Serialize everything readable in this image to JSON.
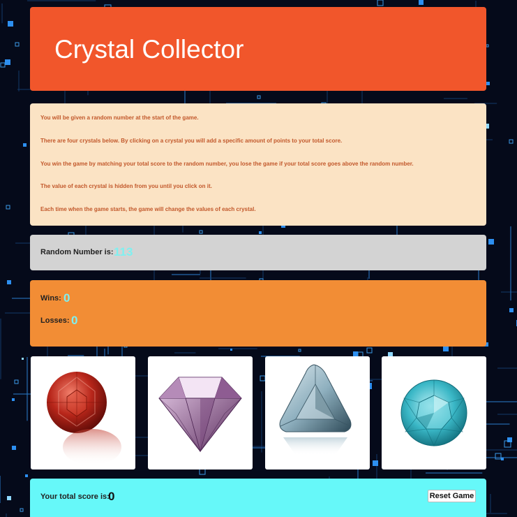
{
  "header": {
    "title": "Crystal Collector"
  },
  "instructions": [
    "You will be given a random number at the start of the game.",
    "There are four crystals below. By clicking on a crystal you will add a specific amount of points to your total score.",
    "You win the game by matching your total score to the random number, you lose the game if your total score goes above the random number.",
    "The value of each crystal is hidden from you until you click on it.",
    "Each time when the game starts, the game will change the values of each crystal."
  ],
  "random": {
    "label": "Random Number is:",
    "value": "113"
  },
  "stats": {
    "wins_label": "Wins:",
    "wins": "0",
    "losses_label": "Losses:",
    "losses": "0"
  },
  "crystals": [
    {
      "name": "red-garnet",
      "icon": "red-round-gem-icon",
      "color": "#b8261a"
    },
    {
      "name": "purple-diamond",
      "icon": "purple-diamond-icon",
      "color": "#8a5a8c"
    },
    {
      "name": "aqua-trillion",
      "icon": "trillion-gem-icon",
      "color": "#8fb0bf"
    },
    {
      "name": "turquoise-round",
      "icon": "turquoise-round-gem-icon",
      "color": "#3ab7c6"
    }
  ],
  "score": {
    "label": "Your total score is:",
    "value": "0",
    "reset_label": "Reset Game"
  },
  "colors": {
    "header": "#f1562b",
    "instructions_bg": "#fbe3c4",
    "instructions_text": "#c2582b",
    "random_bg": "#d3d3d3",
    "stats_bg": "#f28d35",
    "value_text": "#7ff0f0",
    "score_bg": "#66f8f9",
    "background": "#050a1a"
  }
}
